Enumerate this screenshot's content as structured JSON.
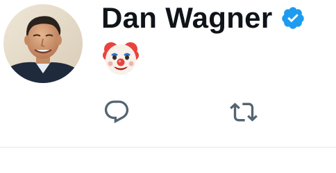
{
  "tweet": {
    "display_name": "Dan Wagner",
    "verified": true,
    "text": "🤡"
  },
  "icons": {
    "verified": "verified-badge-icon",
    "reply": "reply-icon",
    "retweet": "retweet-icon",
    "emoji": "clown-face-emoji"
  },
  "colors": {
    "name": "#0f1419",
    "verified": "#1d9bf0",
    "action": "#536471",
    "divider": "#eff3f4"
  }
}
